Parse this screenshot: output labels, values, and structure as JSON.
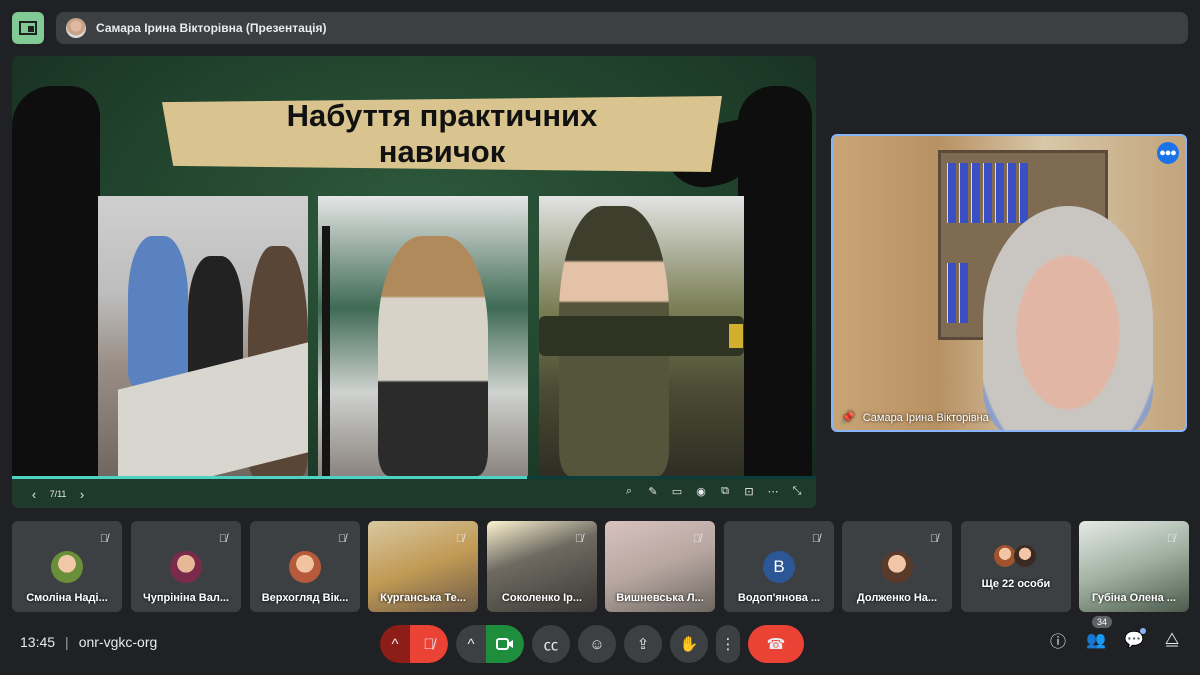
{
  "topbar": {
    "presenter_title": "Самара Ірина Вікторівна (Презентація)"
  },
  "slide": {
    "title": "Набуття практичних навичок",
    "page": "7/11",
    "progress_fraction": 0.64
  },
  "speaker": {
    "name": "Самара Ірина Вікторівна"
  },
  "participants": [
    {
      "name": "Смоліна Наді...",
      "muted": true
    },
    {
      "name": "Чупрініна Вал...",
      "muted": true
    },
    {
      "name": "Верхогляд Вік...",
      "muted": true
    },
    {
      "name": "Курганська Те...",
      "muted": true
    },
    {
      "name": "Соколенко Ір...",
      "muted": true
    },
    {
      "name": "Вишневська Л...",
      "muted": true
    },
    {
      "name": "Водоп'янова ...",
      "muted": true,
      "avatar_letter": "В"
    },
    {
      "name": "Долженко На...",
      "muted": true
    },
    {
      "name": "Ще 22 особи"
    },
    {
      "name": "Губіна Олена ...",
      "muted": true
    }
  ],
  "bottom": {
    "time": "13:45",
    "meeting_code": "onr-vgkc-org",
    "people_count": "34"
  },
  "colors": {
    "accent": "#8ab4f8",
    "danger": "#ea4335",
    "camera_on": "#1e8e3e"
  }
}
